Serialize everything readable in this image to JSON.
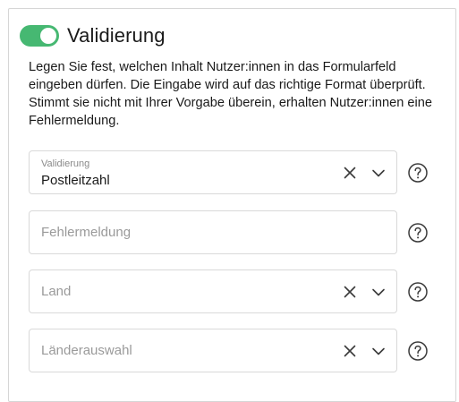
{
  "validation": {
    "toggle_on": true,
    "title": "Validierung",
    "description": "Legen Sie fest, welchen Inhalt Nutzer:innen in das Formularfeld eingeben dürfen. Die Eingabe wird auf das richtige Format überprüft. Stimmt sie nicht mit Ihrer Vorgabe überein, erhalten Nutzer:innen eine Fehlermeldung."
  },
  "fields": {
    "validation_select": {
      "label": "Validierung",
      "value": "Postleitzahl"
    },
    "error_message": {
      "placeholder": "Fehlermeldung"
    },
    "country": {
      "placeholder": "Land"
    },
    "country_selection": {
      "placeholder": "Länderauswahl"
    }
  },
  "icons": {
    "clear": "close-icon",
    "chevron": "chevron-down-icon",
    "help": "help-circle-icon"
  },
  "colors": {
    "toggle_on": "#46b872",
    "text": "#1a1a1a",
    "placeholder": "#9a9a9a",
    "border": "#d9d9d9"
  }
}
